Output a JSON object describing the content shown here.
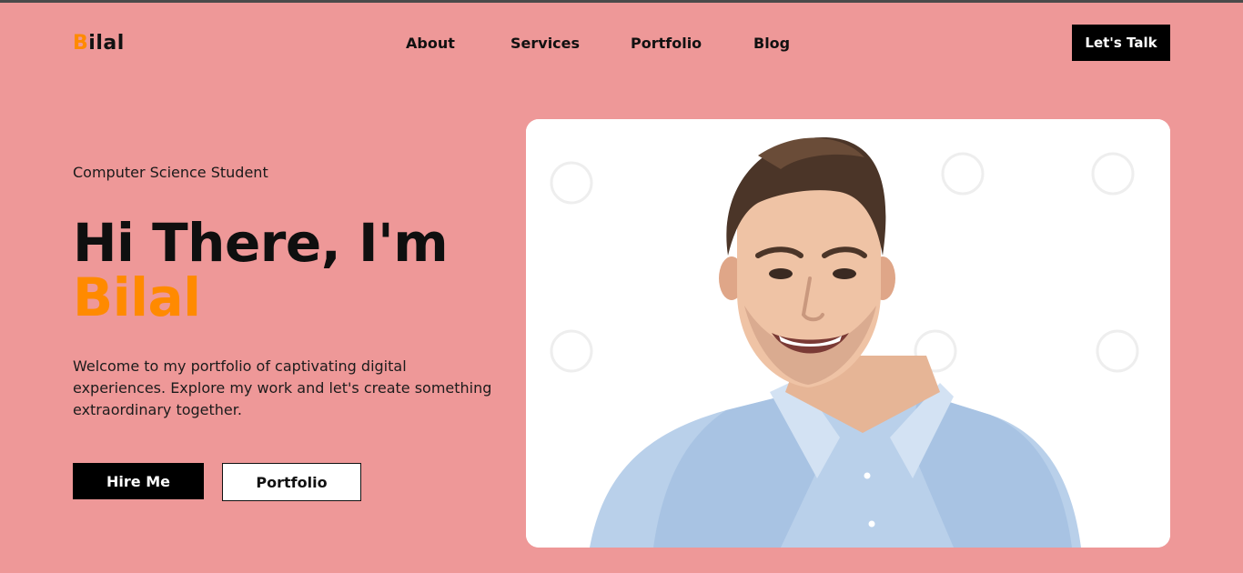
{
  "header": {
    "logo_first_letter": "B",
    "logo_rest": "ilal",
    "nav": [
      "About",
      "Services",
      "Portfolio",
      "Blog"
    ],
    "cta_label": "Let's Talk"
  },
  "hero": {
    "subtitle": "Computer Science Student",
    "headline_prefix": "Hi There, I'm",
    "headline_name": "Bilal",
    "description": "Welcome to my portfolio of captivating digital experiences. Explore my work and let's create something extraordinary together.",
    "primary_button": "Hire Me",
    "secondary_button": "Portfolio"
  },
  "colors": {
    "background": "#ee9898",
    "accent": "#ff8a00",
    "dark": "#000000"
  }
}
